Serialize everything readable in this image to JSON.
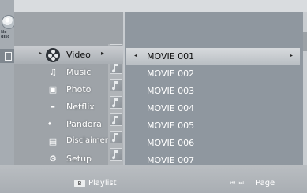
{
  "top_left": {
    "disc_status": "No disc"
  },
  "menu": {
    "items": [
      {
        "label": "Video",
        "icon": "film-reel-icon",
        "selected": true
      },
      {
        "label": "Music",
        "icon": "music-icon",
        "selected": false
      },
      {
        "label": "Photo",
        "icon": "photo-icon",
        "selected": false
      },
      {
        "label": "Netflix",
        "icon": "netflix-icon",
        "selected": false
      },
      {
        "label": "Pandora",
        "icon": "pandora-icon",
        "selected": false
      },
      {
        "label": "Disclaimer",
        "icon": "disclaimer-icon",
        "selected": false
      },
      {
        "label": "Setup",
        "icon": "gear-icon",
        "selected": false
      }
    ]
  },
  "content": {
    "items": [
      {
        "label": "MOVIE 001",
        "selected": true
      },
      {
        "label": "MOVIE 002",
        "selected": false
      },
      {
        "label": "MOVIE 003",
        "selected": false
      },
      {
        "label": "MOVIE 004",
        "selected": false
      },
      {
        "label": "MOVIE 005",
        "selected": false
      },
      {
        "label": "MOVIE 006",
        "selected": false
      },
      {
        "label": "MOVIE 007",
        "selected": false
      }
    ]
  },
  "bottom_bar": {
    "playlist_key": "B",
    "playlist_label": "Playlist",
    "page_label": "Page"
  }
}
